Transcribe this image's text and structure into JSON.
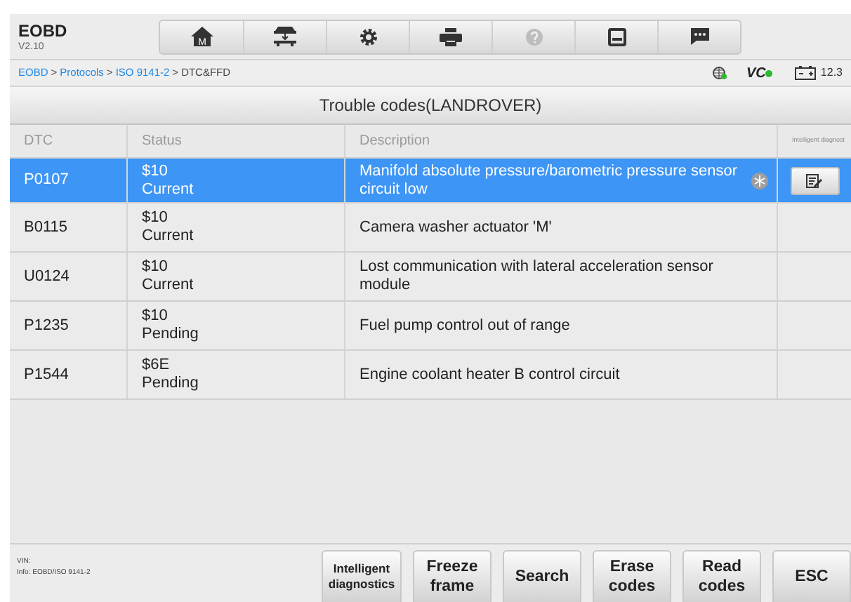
{
  "app": {
    "title": "EOBD",
    "version": "V2.10"
  },
  "toolbar": [
    {
      "kind": "home",
      "label": "M"
    },
    {
      "kind": "car"
    },
    {
      "kind": "settings"
    },
    {
      "kind": "print"
    },
    {
      "kind": "help",
      "disabled": true
    },
    {
      "kind": "save"
    },
    {
      "kind": "message"
    }
  ],
  "breadcrumb": [
    {
      "label": "EOBD",
      "link": true
    },
    {
      "separator": ">",
      "label": "Protocols",
      "link": true
    },
    {
      "separator": ">",
      "label": "ISO 9141-2",
      "link": true
    },
    {
      "separator": ">",
      "label": "DTC&FFD",
      "link": false
    }
  ],
  "status": {
    "vci": "VC",
    "battery": "12.3"
  },
  "panel_title": "Trouble codes(LANDROVER)",
  "table": {
    "columns": [
      "DTC",
      "Status",
      "Description",
      "Intelligent diagnost"
    ],
    "rows": [
      {
        "dtc": "P0107",
        "code": "$10",
        "state": "Current",
        "description": "Manifold absolute pressure/barometric pressure sensor circuit low",
        "freeze_frame": true,
        "selected": true
      },
      {
        "dtc": "B0115",
        "code": "$10",
        "state": "Current",
        "description": "Camera washer actuator 'M'",
        "freeze_frame": false,
        "selected": false
      },
      {
        "dtc": "U0124",
        "code": "$10",
        "state": "Current",
        "description": "Lost communication with lateral acceleration sensor module",
        "freeze_frame": false,
        "selected": false
      },
      {
        "dtc": "P1235",
        "code": "$10",
        "state": "Pending",
        "description": "Fuel pump control out of range",
        "freeze_frame": false,
        "selected": false
      },
      {
        "dtc": "P1544",
        "code": "$6E",
        "state": "Pending",
        "description": "Engine coolant heater B control circuit",
        "freeze_frame": false,
        "selected": false
      }
    ]
  },
  "info": {
    "vin": "VIN:",
    "info": "Info: EOBD/ISO 9141-2"
  },
  "buttons": [
    {
      "label": "Intelligent diagnostics",
      "kind": "small"
    },
    {
      "label": "Freeze frame",
      "kind": "normal"
    },
    {
      "label": "Search",
      "kind": "normal"
    },
    {
      "label": "Erase codes",
      "kind": "normal"
    },
    {
      "label": "Read codes",
      "kind": "normal"
    },
    {
      "label": "ESC",
      "kind": "normal"
    }
  ]
}
